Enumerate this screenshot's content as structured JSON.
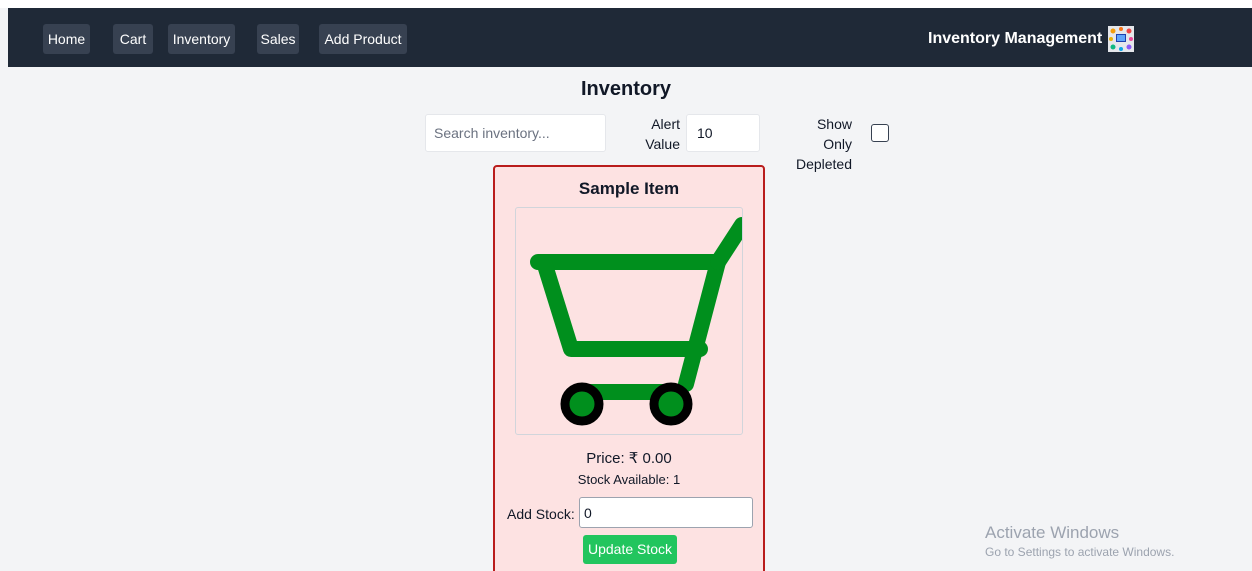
{
  "nav": {
    "items": [
      {
        "label": "Home"
      },
      {
        "label": "Cart"
      },
      {
        "label": "Inventory"
      },
      {
        "label": "Sales"
      },
      {
        "label": "Add Product"
      }
    ],
    "brand": "Inventory Management"
  },
  "page": {
    "title": "Inventory"
  },
  "filters": {
    "search_placeholder": "Search inventory...",
    "alert_label": "Alert Value",
    "alert_value": "10",
    "depleted_label": "Show Only Depleted",
    "depleted_checked": false
  },
  "item": {
    "name": "Sample Item",
    "price": "Price: ₹ 0.00",
    "stock": "Stock Available: 1",
    "add_stock_label": "Add Stock:",
    "add_stock_value": "0",
    "update_button": "Update Stock"
  },
  "watermark": {
    "title": "Activate Windows",
    "subtitle": "Go to Settings to activate Windows."
  },
  "colors": {
    "navbar": "#1f2937",
    "card_background": "#fde2e2",
    "card_border": "#b91c1c",
    "update_button": "#22c55e",
    "cart_icon": "#008f1d"
  },
  "icons": {
    "brand": "inventory-logo-icon",
    "product": "shopping-cart-icon"
  }
}
